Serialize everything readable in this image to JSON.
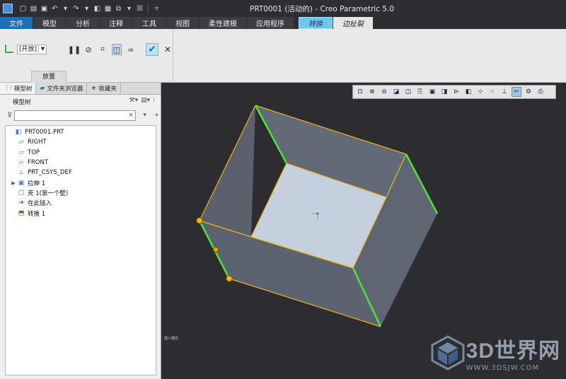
{
  "window": {
    "title": "PRT0001 (活动的) - Creo Parametric 5.0"
  },
  "menu_tabs": [
    {
      "label": "文件",
      "state": "active"
    },
    {
      "label": "模型",
      "state": ""
    },
    {
      "label": "分析",
      "state": ""
    },
    {
      "label": "注释",
      "state": ""
    },
    {
      "label": "工具",
      "state": ""
    },
    {
      "label": "视图",
      "state": ""
    },
    {
      "label": "柔性建模",
      "state": ""
    },
    {
      "label": "应用程序",
      "state": ""
    },
    {
      "label": "转换",
      "state": "ctx1"
    },
    {
      "label": "边扯裂",
      "state": "ctx2"
    }
  ],
  "ribbon": {
    "selection_value": "[开放]",
    "placement_label": "放置"
  },
  "panel": {
    "tabs": [
      "模型树",
      "文件夹浏览器",
      "收藏夹"
    ],
    "tree_heading": "模型树",
    "filter_placeholder": "",
    "tree": [
      {
        "label": "PRT0001.PRT",
        "icon": "part-icon",
        "level": 0,
        "expand": ""
      },
      {
        "label": "RIGHT",
        "icon": "datum-plane-icon",
        "level": 1,
        "expand": ""
      },
      {
        "label": "TOP",
        "icon": "datum-plane-icon",
        "level": 1,
        "expand": ""
      },
      {
        "label": "FRONT",
        "icon": "datum-plane-icon",
        "level": 1,
        "expand": ""
      },
      {
        "label": "PRT_CSYS_DEF",
        "icon": "csys-icon",
        "level": 1,
        "expand": ""
      },
      {
        "label": "拉伸 1",
        "icon": "extrude-icon",
        "level": 1,
        "expand": "▶"
      },
      {
        "label": "壳 1(第一个壁)",
        "icon": "shell-icon",
        "level": 1,
        "expand": ""
      },
      {
        "label": "在此插入",
        "icon": "insert-here-icon",
        "level": 1,
        "expand": ""
      },
      {
        "label": "转换 1",
        "icon": "convert-icon",
        "level": 1,
        "expand": ""
      }
    ]
  },
  "viewport": {
    "status_text": "插入模式",
    "colors": {
      "background": "#2c2c31",
      "face": "#5f6673",
      "top_face": "#c5d0df",
      "edge": "#f2b21b",
      "rip_edge": "#4be03a"
    }
  },
  "watermark": {
    "brand": "3D世界网",
    "url": "WWW.3DSJW.COM"
  }
}
